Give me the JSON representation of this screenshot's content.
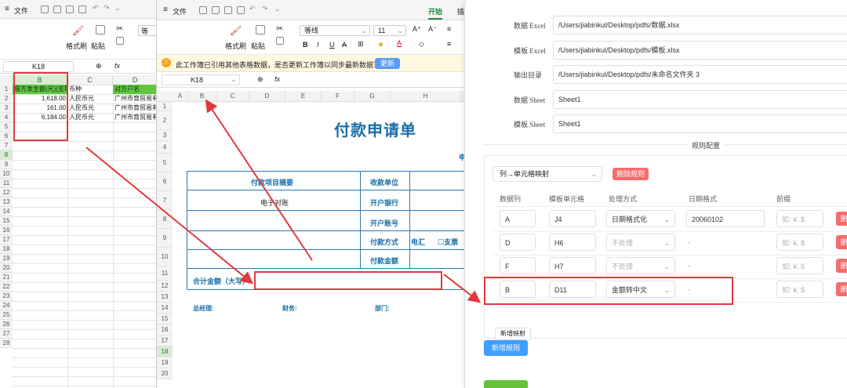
{
  "left": {
    "menu_file": "文件",
    "format_painter": "格式刷",
    "paste": "粘贴",
    "font_partial": "等",
    "cell_ref": "K18",
    "fx": "fx",
    "cols": [
      "A",
      "B",
      "C",
      "D"
    ],
    "rows": [
      "1",
      "2",
      "3",
      "4",
      "5",
      "6",
      "7",
      "8",
      "9",
      "10",
      "11",
      "12",
      "13",
      "14",
      "15",
      "16",
      "17",
      "18",
      "19",
      "20",
      "21",
      "22",
      "23",
      "24",
      "25",
      "26",
      "27",
      "28"
    ],
    "header_row": {
      "b": "借方发生额(元)(支取",
      "c": "币种",
      "d": "对方户名"
    },
    "data": [
      {
        "b": "1,618.00",
        "c": "人民币元",
        "d": "广州市育贸易有"
      },
      {
        "b": "161.00",
        "c": "人民币元",
        "d": "广州市育贸易有"
      },
      {
        "b": "6,184.00",
        "c": "人民币元",
        "d": "广州市育贸易有"
      }
    ]
  },
  "mid": {
    "menu_file": "文件",
    "tab_start": "开始",
    "tab_insert_partial": "插",
    "format_painter": "格式刷",
    "paste": "粘贴",
    "font_name": "等线",
    "font_size": "11",
    "notice": "此工作簿已引用其他表格数据，是否更新工作簿以同步最新数据？",
    "update_button": "更新",
    "cell_ref": "K18",
    "fx": "fx",
    "cols": [
      "A",
      "B",
      "C",
      "D",
      "E",
      "F",
      "G",
      "H"
    ],
    "rows": [
      "1",
      "2",
      "3",
      "4",
      "5",
      "6",
      "7",
      "8",
      "9",
      "10",
      "11",
      "12",
      "13",
      "14",
      "15",
      "16",
      "17",
      "18",
      "19",
      "20"
    ],
    "title": "付款申请单",
    "right_partial": "申",
    "form": {
      "summary_label": "付款项目摘要",
      "summary_value": "电子对账",
      "payee": "收款单位",
      "bank": "开户银行",
      "account": "开户账号",
      "method": "付款方式",
      "method_wire": "电汇",
      "method_check": "☐支票",
      "amount": "付款金额",
      "total": "合计金额（大写）",
      "gm": "总经理:",
      "finance": "财务:",
      "dept": "部门:"
    }
  },
  "panel": {
    "labels": {
      "data_excel": "数据 Excel",
      "template_excel": "模板 Excel",
      "output_dir": "输出目录",
      "data_sheet": "数据 Sheet",
      "template_sheet": "模板 Sheet"
    },
    "values": {
      "data_excel": "/Users/jiabinkul/Desktop/pdfs/数据.xlsx",
      "template_excel": "/Users/jiabinkul/Desktop/pdfs/模板.xlsx",
      "output_dir": "/Users/jiabinkul/Desktop/pdfs/未命名文件夹 3",
      "data_sheet": "Sheet1",
      "template_sheet": "Sheet1"
    },
    "rule_config": "规则配置",
    "rule_type": "列→单元格映射",
    "delete_rule": "删除规则",
    "headers": {
      "data_col": "数据列",
      "template_cell": "模板单元格",
      "process": "处理方式",
      "date_format": "日期格式",
      "prefix": "前缀"
    },
    "rows": [
      {
        "col": "A",
        "cell": "J4",
        "process": "日期格式化",
        "date": "20060102",
        "prefix": "如: ¥, $"
      },
      {
        "col": "D",
        "cell": "H6",
        "process": "不处理",
        "date": "-",
        "prefix": "如: ¥, $"
      },
      {
        "col": "F",
        "cell": "H7",
        "process": "不处理",
        "date": "-",
        "prefix": "如: ¥, $"
      },
      {
        "col": "B",
        "cell": "D11",
        "process": "金额转中文",
        "date": "-",
        "prefix": "如: ¥, $"
      }
    ],
    "delete_partial": "删",
    "add_mapping": "新增映射",
    "add_rule": "新增规则",
    "colors": {
      "primary": "#409eff",
      "danger": "#f56c6c",
      "success": "#67c23a",
      "highlight": "#e0393e"
    }
  }
}
